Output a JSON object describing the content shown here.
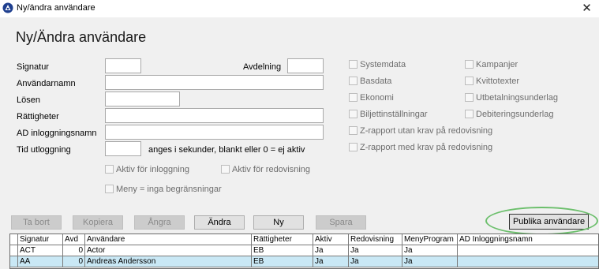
{
  "window": {
    "title": "Ny/ändra användare",
    "close_glyph": "✕"
  },
  "form": {
    "heading": "Ny/Ändra användare",
    "labels": {
      "signatur": "Signatur",
      "avdelning": "Avdelning",
      "anvandarnamn": "Användarnamn",
      "losen": "Lösen",
      "rattigheter": "Rättigheter",
      "ad_inloggningsnamn": "AD inloggningsnamn",
      "tid_utloggning": "Tid utloggning",
      "tid_hint": "anges i sekunder, blankt eller 0 = ej aktiv"
    },
    "values": {
      "signatur": "",
      "avdelning": "",
      "anvandarnamn": "",
      "losen": "",
      "rattigheter": "",
      "ad_inloggningsnamn": "",
      "tid_utloggning": ""
    },
    "checkboxes": {
      "aktiv_inloggning": "Aktiv för inloggning",
      "aktiv_redovisning": "Aktiv för redovisning",
      "meny_inga": "Meny = inga begränsningar"
    }
  },
  "permissions": {
    "left": [
      "Systemdata",
      "Basdata",
      "Ekonomi",
      "Biljettinställningar"
    ],
    "right": [
      "Kampanjer",
      "Kvittotexter",
      "Utbetalningsunderlag",
      "Debiteringsunderlag"
    ],
    "wide": [
      "Z-rapport utan krav på  redovisning",
      "Z-rapport med krav på redovisning"
    ]
  },
  "buttons": {
    "ta_bort": "Ta bort",
    "kopiera": "Kopiera",
    "angra": "Ångra",
    "andra": "Ändra",
    "ny": "Ny",
    "spara": "Spara",
    "publika": "Publika användare"
  },
  "table": {
    "columns": [
      "Signatur",
      "Avd",
      "Användare",
      "Rättigheter",
      "Aktiv",
      "Redovisning",
      "MenyProgram",
      "AD Inloggningsnamn"
    ],
    "rows": [
      [
        "ACT",
        "0",
        "Actor",
        "EB",
        "Ja",
        "Ja",
        "Ja",
        ""
      ],
      [
        "AA",
        "0",
        "Andreas Andersson",
        "EB",
        "Ja",
        "Ja",
        "Ja",
        ""
      ]
    ]
  },
  "colors": {
    "highlight_ring": "#6cbf6c",
    "selected_row": "#c9e8f5"
  }
}
